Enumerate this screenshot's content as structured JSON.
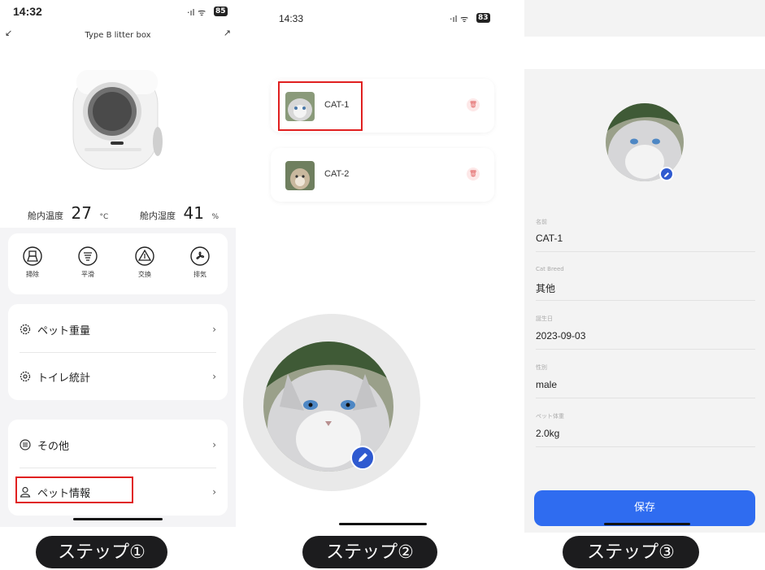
{
  "panel1": {
    "status": {
      "time": "14:32",
      "signal": "·ıl ᯤ",
      "battery": "85"
    },
    "header": {
      "title": "Type B litter box"
    },
    "temp_label": "舱内温度",
    "temp_value": "27",
    "temp_unit": "°C",
    "humid_label": "舱内湿度",
    "humid_value": "41",
    "humid_unit": "%",
    "actions": [
      {
        "label": "掃除",
        "icon": "broom-icon"
      },
      {
        "label": "平滑",
        "icon": "smooth-icon"
      },
      {
        "label": "交換",
        "icon": "exchange-icon"
      },
      {
        "label": "排気",
        "icon": "fan-icon"
      }
    ],
    "menu1": [
      {
        "label": "ペット重量",
        "icon": "gear-icon"
      },
      {
        "label": "トイレ統計",
        "icon": "gear-icon"
      }
    ],
    "menu2": [
      {
        "label": "その他",
        "icon": "list-icon"
      },
      {
        "label": "ペット情報",
        "icon": "person-icon"
      }
    ],
    "chevron": "›",
    "step_label": "ステップ①"
  },
  "panel2": {
    "status": {
      "time": "14:33",
      "signal": "·ıl ᯤ",
      "battery": "83"
    },
    "cats": [
      {
        "name": "CAT-1"
      },
      {
        "name": "CAT-2"
      }
    ],
    "trash_glyph": "🗑",
    "step_label": "ステップ②"
  },
  "panel3": {
    "fields": [
      {
        "label": "名前",
        "value": "CAT-1"
      },
      {
        "label": "Cat Breed",
        "value": "其他"
      },
      {
        "label": "誕生日",
        "value": "2023-09-03"
      },
      {
        "label": "性別",
        "value": "male"
      },
      {
        "label": "ペット体重",
        "value": "2.0kg"
      }
    ],
    "save_label": "保存",
    "step_label": "ステップ③"
  },
  "colors": {
    "accent": "#2f6cf0",
    "highlight": "#e02020",
    "step_bg": "#1c1c1e"
  }
}
